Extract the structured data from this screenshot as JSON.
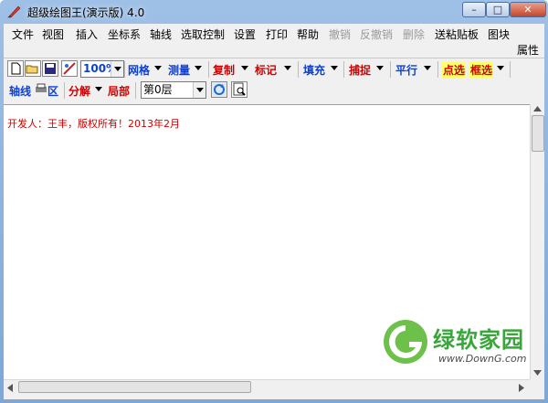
{
  "window": {
    "title": "超级绘图王(演示版) 4.0",
    "controls": {
      "minimize": "–",
      "maximize": "□",
      "close": "✕"
    }
  },
  "menu": {
    "items": [
      {
        "label": "文件",
        "enabled": true
      },
      {
        "label": "视图",
        "enabled": true
      },
      {
        "label": "插入",
        "enabled": true
      },
      {
        "label": "坐标系",
        "enabled": true
      },
      {
        "label": "轴线",
        "enabled": true
      },
      {
        "label": "选取控制",
        "enabled": true
      },
      {
        "label": "设置",
        "enabled": true
      },
      {
        "label": "打印",
        "enabled": true
      },
      {
        "label": "帮助",
        "enabled": true
      },
      {
        "label": "撤销",
        "enabled": false
      },
      {
        "label": "反撤销",
        "enabled": false
      },
      {
        "label": "删除",
        "enabled": false
      },
      {
        "label": "送粘贴板",
        "enabled": true
      },
      {
        "label": "图块",
        "enabled": true
      }
    ],
    "second_row": "属性"
  },
  "toolbar1": {
    "zoom": "100%",
    "grid": "网格",
    "measure": "测量",
    "copy": "复制",
    "mark": "标记",
    "fill": "填充",
    "snap": "捕捉",
    "parallel": "平行",
    "point_select": "点选",
    "box_select": "框选"
  },
  "toolbar2": {
    "axis": "轴线",
    "area": "区",
    "split": "分解",
    "local": "局部",
    "layer": "第0层"
  },
  "canvas": {
    "credit": "开发人：王丰，版权所有！2013年2月"
  },
  "watermark": {
    "name": "绿软家园",
    "url": "www.DownG.com"
  },
  "colors": {
    "blue_label": "#0b3fd6",
    "red_label": "#d00000",
    "highlight": "#ffff66"
  }
}
